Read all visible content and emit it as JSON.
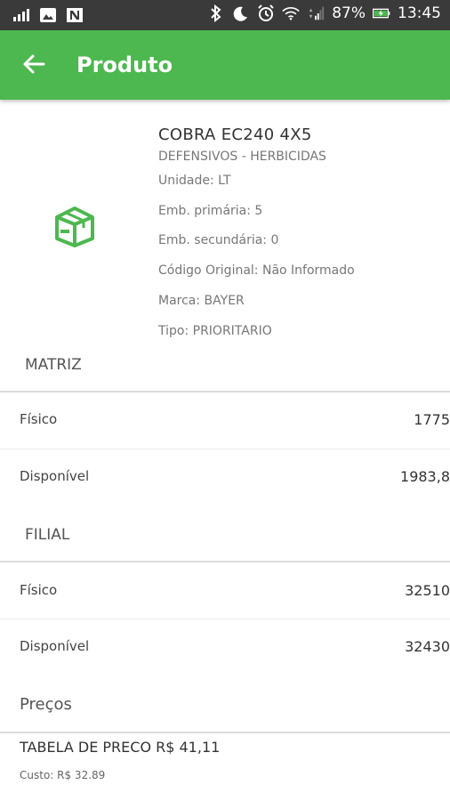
{
  "status_bar": {
    "battery": "87%",
    "time": "13:45"
  },
  "app_bar": {
    "title": "Produto"
  },
  "product": {
    "name": "COBRA EC240  4X5",
    "category": "DEFENSIVOS - HERBICIDAS",
    "details": [
      "Unidade: LT",
      "Emb. primária: 5",
      "Emb. secundária: 0",
      "Código Original: Não Informado",
      "Marca: BAYER",
      "Tipo: PRIORITARIO"
    ]
  },
  "matriz": {
    "title": "MATRIZ",
    "fisico_label": "Físico",
    "fisico_value": "1775",
    "disponivel_label": "Disponível",
    "disponivel_value": "1983,8"
  },
  "filial": {
    "title": "FILIAL",
    "fisico_label": "Físico",
    "fisico_value": "32510",
    "disponivel_label": "Disponível",
    "disponivel_value": "32430"
  },
  "precos": {
    "title": "Preços",
    "tabela": "TABELA DE PRECO  R$ 41,11",
    "custo": "Custo: R$ 32.89"
  },
  "colors": {
    "primary": "#4cb84f",
    "status_bar": "#3a3a3a"
  }
}
